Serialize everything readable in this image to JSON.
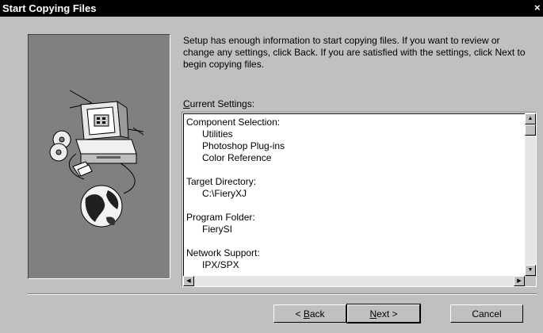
{
  "window": {
    "title": "Start Copying Files",
    "close_label": "×"
  },
  "intro": {
    "text": "Setup has enough information to start copying files.  If you want to review or change any settings, click Back.  If you are satisfied with the settings, click Next to begin copying files."
  },
  "settings": {
    "label_mnemonic": "C",
    "label_rest": "urrent Settings:",
    "sections": [
      {
        "heading": "Component Selection:",
        "items": [
          "Utilities",
          "Photoshop Plug-ins",
          "Color Reference"
        ]
      },
      {
        "heading": "Target Directory:",
        "items": [
          "C:\\FieryXJ"
        ]
      },
      {
        "heading": "Program Folder:",
        "items": [
          "FierySI"
        ]
      },
      {
        "heading": "Network Support:",
        "items": [
          "IPX/SPX"
        ]
      }
    ]
  },
  "buttons": {
    "back_pre": "< ",
    "back_mnemonic": "B",
    "back_rest": "ack",
    "next_mnemonic": "N",
    "next_rest": "ext >",
    "cancel": "Cancel"
  },
  "icons": {
    "graphic": "computer-cd-globe-illustration",
    "scroll_up": "arrow-up-icon",
    "scroll_down": "arrow-down-icon",
    "scroll_left": "arrow-left-icon",
    "scroll_right": "arrow-right-icon"
  }
}
